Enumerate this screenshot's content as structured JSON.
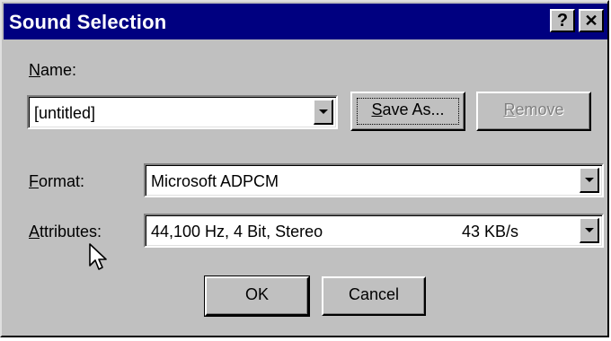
{
  "window": {
    "title": "Sound Selection",
    "help_glyph": "?",
    "close_glyph": "✕"
  },
  "name": {
    "label_underlined": "N",
    "label_rest": "ame:",
    "value": "[untitled]"
  },
  "buttons": {
    "save_as_underlined": "S",
    "save_as_rest": "ave As...",
    "remove_underlined": "R",
    "remove_rest": "emove",
    "ok": "OK",
    "cancel": "Cancel"
  },
  "format": {
    "label_underlined": "F",
    "label_rest": "ormat:",
    "value": "Microsoft ADPCM"
  },
  "attributes": {
    "label_underlined": "A",
    "label_rest": "ttributes:",
    "value": "44,100 Hz, 4 Bit, Stereo",
    "rate": "43 KB/s"
  }
}
